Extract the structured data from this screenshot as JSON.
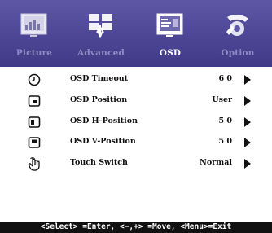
{
  "tabs": [
    {
      "label": "Picture",
      "icon": "picture-icon",
      "active": false
    },
    {
      "label": "Advanced",
      "icon": "advanced-icon",
      "active": false
    },
    {
      "label": "OSD",
      "icon": "osd-icon",
      "active": true
    },
    {
      "label": "Option",
      "icon": "option-icon",
      "active": false
    }
  ],
  "menu": {
    "items": [
      {
        "label": "OSD Timeout",
        "value": "6 0",
        "icon": "clock-icon"
      },
      {
        "label": "OSD Position",
        "value": "User",
        "icon": "osd-position-icon"
      },
      {
        "label": "OSD H-Position",
        "value": "5 0",
        "icon": "h-position-icon"
      },
      {
        "label": "OSD V-Position",
        "value": "5 0",
        "icon": "v-position-icon"
      },
      {
        "label": "Touch Switch",
        "value": "Normal",
        "icon": "touch-icon"
      }
    ]
  },
  "footer": {
    "hint": "<Select> =Enter, <−,+> =Move, <Menu>=Exit"
  },
  "colors": {
    "tabbar": "#4c4695",
    "inactive_label": "#8f8ac4",
    "active_label": "#ffffff",
    "footer_bg": "#111111"
  }
}
